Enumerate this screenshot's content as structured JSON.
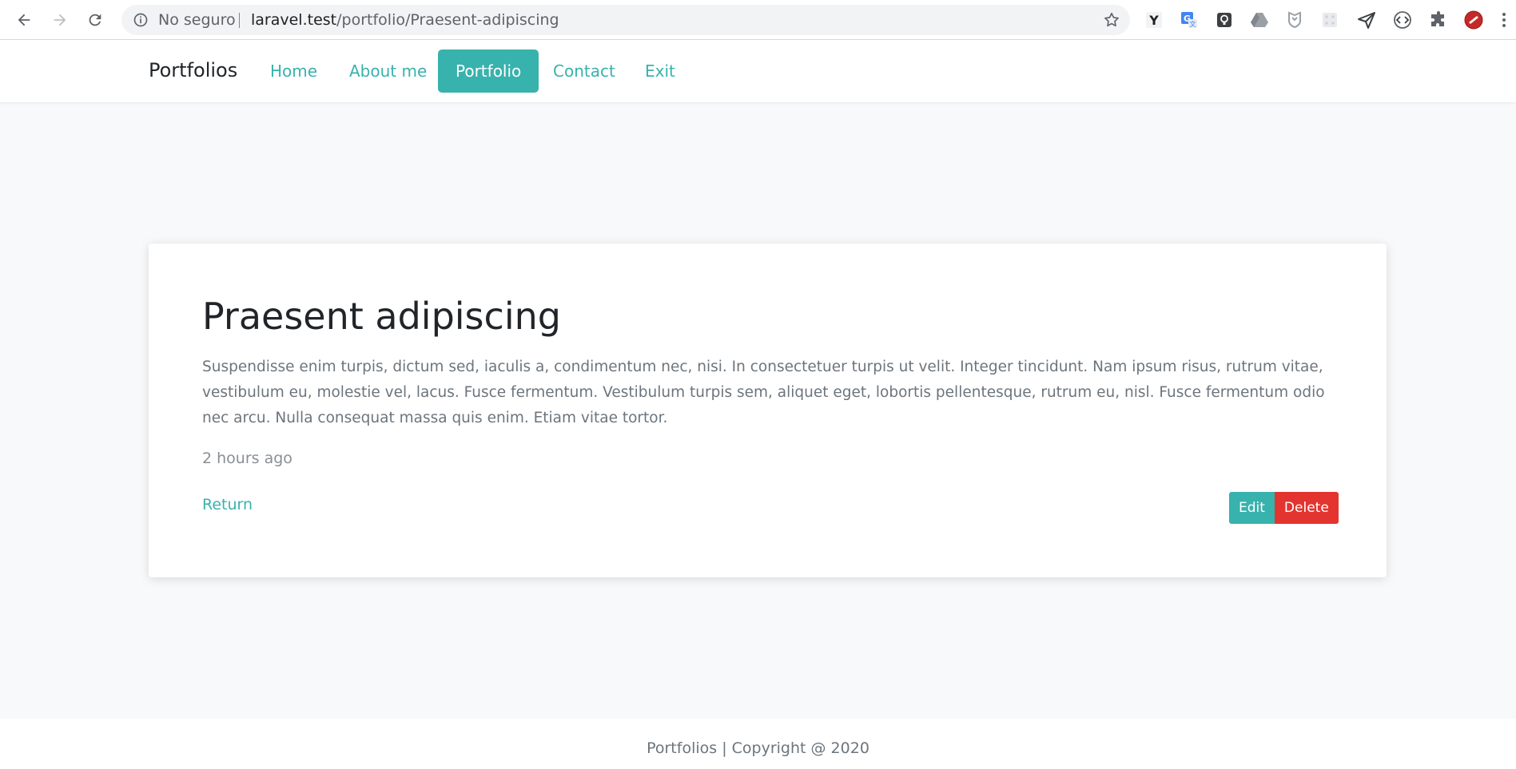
{
  "browser": {
    "security_label": "No seguro",
    "url_host": "laravel.test",
    "url_path": "/portfolio/Praesent-adipiscing",
    "extensions": [
      {
        "name": "y-extension-icon",
        "glyph": "Y"
      },
      {
        "name": "translate-extension-icon",
        "glyph": "G"
      },
      {
        "name": "lightbulb-extension-icon",
        "glyph": ""
      },
      {
        "name": "drive-extension-icon",
        "glyph": ""
      },
      {
        "name": "shield-extension-icon",
        "glyph": ""
      },
      {
        "name": "grid-extension-icon",
        "glyph": ""
      },
      {
        "name": "send-extension-icon",
        "glyph": ""
      },
      {
        "name": "code-extension-icon",
        "glyph": ""
      },
      {
        "name": "puzzle-extension-icon",
        "glyph": ""
      },
      {
        "name": "profile-avatar-icon",
        "glyph": ""
      }
    ]
  },
  "navbar": {
    "brand": "Portfolios",
    "links": [
      {
        "label": "Home",
        "active": false
      },
      {
        "label": "About me",
        "active": false
      },
      {
        "label": "Portfolio",
        "active": true
      },
      {
        "label": "Contact",
        "active": false
      },
      {
        "label": "Exit",
        "active": false
      }
    ]
  },
  "project": {
    "title": "Praesent adipiscing",
    "description": "Suspendisse enim turpis, dictum sed, iaculis a, condimentum nec, nisi. In consectetuer turpis ut velit. Integer tincidunt. Nam ipsum risus, rutrum vitae, vestibulum eu, molestie vel, lacus. Fusce fermentum. Vestibulum turpis sem, aliquet eget, lobortis pellentesque, rutrum eu, nisl. Fusce fermentum odio nec arcu. Nulla consequat massa quis enim. Etiam vitae tortor.",
    "time_ago": "2 hours ago",
    "return_label": "Return",
    "edit_label": "Edit",
    "delete_label": "Delete"
  },
  "footer": {
    "text": "Portfolios | Copyright @ 2020"
  },
  "colors": {
    "accent": "#38b2ac",
    "danger": "#e3342f",
    "page_bg": "#f8f9fa"
  }
}
